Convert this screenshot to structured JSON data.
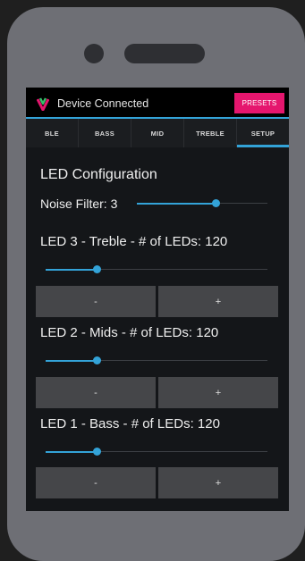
{
  "header": {
    "title": "Device Connected",
    "presets_label": "PRESETS",
    "accent_color": "#33a3d8",
    "presets_color": "#e5166e"
  },
  "tabs": [
    {
      "label": "BLE"
    },
    {
      "label": "BASS"
    },
    {
      "label": "MID"
    },
    {
      "label": "TREBLE"
    },
    {
      "label": "SETUP",
      "active": true
    }
  ],
  "setup": {
    "section_title": "LED Configuration",
    "noise_filter": {
      "label": "Noise Filter: 3",
      "value_fraction": 0.6
    },
    "leds": [
      {
        "label": "LED 3 - Treble - # of LEDs: 120",
        "value_fraction": 0.23,
        "minus": "-",
        "plus": "+"
      },
      {
        "label": "LED 2 - Mids - # of LEDs: 120",
        "value_fraction": 0.23,
        "minus": "-",
        "plus": "+"
      },
      {
        "label": "LED 1 - Bass - # of LEDs: 120",
        "value_fraction": 0.23,
        "minus": "-",
        "plus": "+"
      }
    ]
  },
  "icons": {
    "logo": "v-logo-icon"
  }
}
